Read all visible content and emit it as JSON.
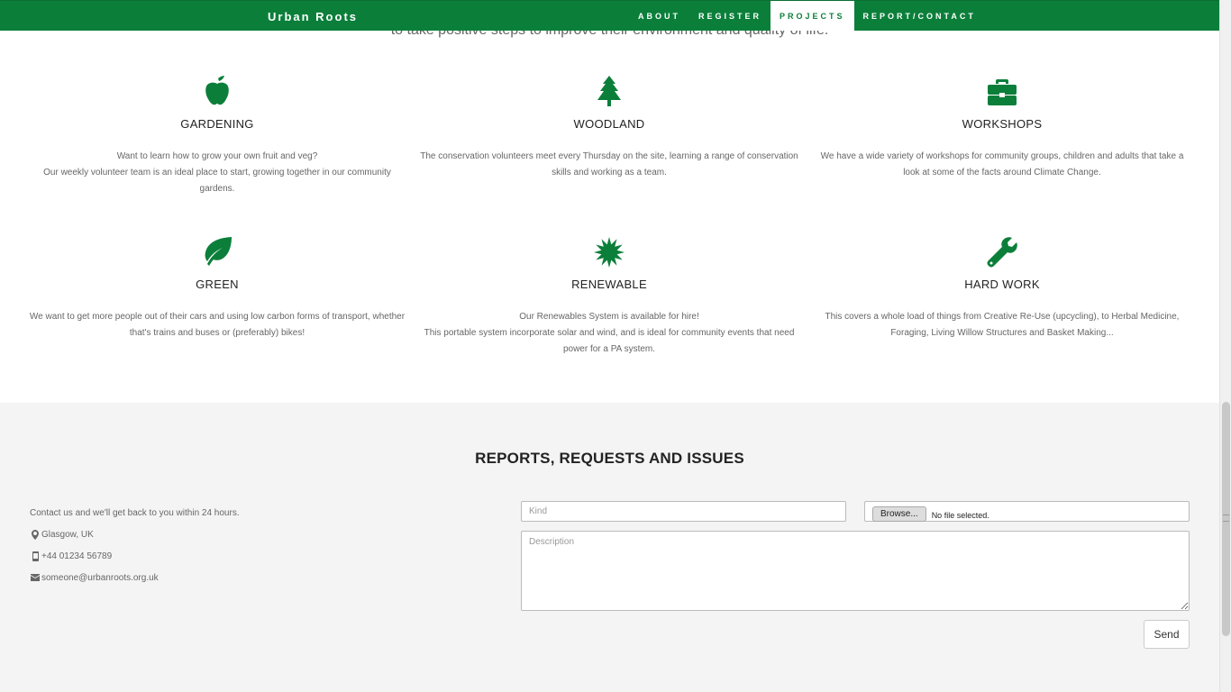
{
  "nav": {
    "brand": "Urban Roots",
    "items": [
      {
        "label": "ABOUT",
        "active": false
      },
      {
        "label": "REGISTER",
        "active": false
      },
      {
        "label": "PROJECTS",
        "active": true
      },
      {
        "label": "REPORT/CONTACT",
        "active": false
      }
    ]
  },
  "intro_clip": "to take positive steps to improve their environment and quality of life.",
  "features": [
    {
      "icon": "apple-icon",
      "title": "GARDENING",
      "text_lines": [
        "Want to learn how to grow your own fruit and veg?",
        "Our weekly volunteer team is an ideal place to start, growing together in our community gardens."
      ]
    },
    {
      "icon": "tree-icon",
      "title": "WOODLAND",
      "text_lines": [
        "The conservation volunteers meet every Thursday on the site, learning a range of conservation skills and working as a team."
      ]
    },
    {
      "icon": "briefcase-icon",
      "title": "WORKSHOPS",
      "text_lines": [
        "We have a wide variety of workshops for community groups, children and adults that take a look at some of the facts around Climate Change."
      ]
    },
    {
      "icon": "leaf-icon",
      "title": "GREEN",
      "text_lines": [
        "We want to get more people out of their cars and using low carbon forms of transport, whether that's trains and buses or (preferably) bikes!"
      ]
    },
    {
      "icon": "sun-icon",
      "title": "RENEWABLE",
      "text_lines": [
        "Our Renewables System is available for hire!",
        "This portable system incorporate solar and wind, and is ideal for community events that need power for a PA system."
      ]
    },
    {
      "icon": "wrench-icon",
      "title": "HARD WORK",
      "text_lines": [
        "This covers a whole load of things from Creative Re-Use (upcycling), to Herbal Medicine, Foraging, Living Willow Structures and Basket Making..."
      ]
    }
  ],
  "contact": {
    "title": "REPORTS, REQUESTS AND ISSUES",
    "intro": "Contact us and we'll get back to you within 24 hours.",
    "location": "Glasgow, UK",
    "phone": "+44 01234 56789",
    "email": "someone@urbanroots.org.uk",
    "kind_placeholder": "Kind",
    "browse_label": "Browse...",
    "file_status": "No file selected.",
    "description_placeholder": "Description",
    "send_label": "Send"
  },
  "colors": {
    "brand_green": "#0b7f3a",
    "section_bg": "#f4f4f4"
  }
}
